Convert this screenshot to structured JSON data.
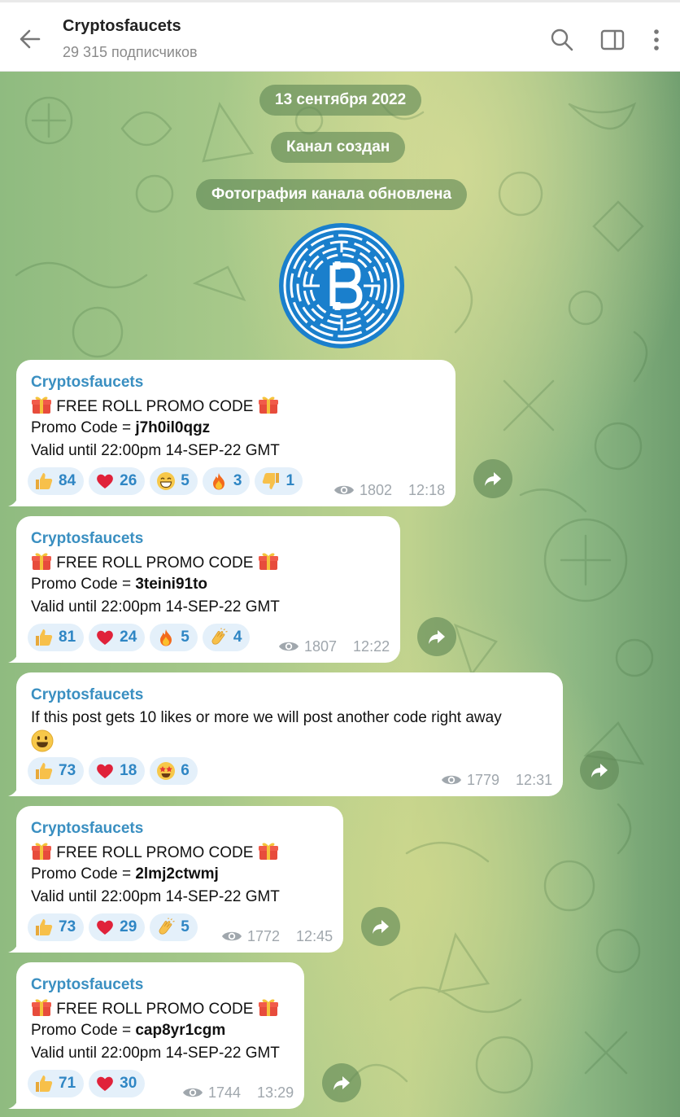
{
  "header": {
    "title": "Cryptosfaucets",
    "subtitle": "29 315 подписчиков",
    "icons": [
      "back-arrow-icon",
      "search-icon",
      "sidebar-panel-icon",
      "more-vertical-icon"
    ]
  },
  "service": {
    "date": "13 сентября 2022",
    "created": "Канал создан",
    "photo_updated": "Фотография канала обновлена"
  },
  "colors": {
    "sender": "#3a8fc1",
    "reaction_bg": "#e4f0fa",
    "reaction_count": "#2f86c4",
    "pill_bg": "#608856"
  },
  "messages": [
    {
      "sender": "Cryptosfaucets",
      "title": "FREE ROLL PROMO CODE",
      "promo_label": "Promo Code = ",
      "promo_code": "j7h0il0qgz",
      "valid": "Valid until 22:00pm 14-SEP-22 GMT",
      "reactions": [
        {
          "emoji": "thumbs-up",
          "count": "84"
        },
        {
          "emoji": "heart",
          "count": "26"
        },
        {
          "emoji": "grin",
          "count": "5"
        },
        {
          "emoji": "fire",
          "count": "3"
        },
        {
          "emoji": "thumbs-down",
          "count": "1"
        }
      ],
      "views": "1802",
      "time": "12:18"
    },
    {
      "sender": "Cryptosfaucets",
      "title": "FREE ROLL PROMO CODE",
      "promo_label": "Promo Code = ",
      "promo_code": "3teini91to",
      "valid": "Valid until 22:00pm 14-SEP-22 GMT",
      "reactions": [
        {
          "emoji": "thumbs-up",
          "count": "81"
        },
        {
          "emoji": "heart",
          "count": "24"
        },
        {
          "emoji": "fire",
          "count": "5"
        },
        {
          "emoji": "clap",
          "count": "4"
        }
      ],
      "views": "1807",
      "time": "12:22"
    },
    {
      "sender": "Cryptosfaucets",
      "text": "If this post gets 10 likes or more we will post another code right away",
      "reactions": [
        {
          "emoji": "thumbs-up",
          "count": "73"
        },
        {
          "emoji": "heart",
          "count": "18"
        },
        {
          "emoji": "star-struck",
          "count": "6"
        }
      ],
      "views": "1779",
      "time": "12:31"
    },
    {
      "sender": "Cryptosfaucets",
      "title": "FREE ROLL PROMO CODE",
      "promo_label": "Promo Code = ",
      "promo_code": "2lmj2ctwmj",
      "valid": "Valid until 22:00pm 14-SEP-22 GMT",
      "reactions": [
        {
          "emoji": "thumbs-up",
          "count": "73"
        },
        {
          "emoji": "heart",
          "count": "29"
        },
        {
          "emoji": "clap",
          "count": "5"
        }
      ],
      "views": "1772",
      "time": "12:45"
    },
    {
      "sender": "Cryptosfaucets",
      "title": "FREE ROLL PROMO CODE",
      "promo_label": "Promo Code = ",
      "promo_code": "cap8yr1cgm",
      "valid": "Valid until 22:00pm 14-SEP-22 GMT",
      "reactions": [
        {
          "emoji": "thumbs-up",
          "count": "71"
        },
        {
          "emoji": "heart",
          "count": "30"
        }
      ],
      "views": "1744",
      "time": "13:29"
    }
  ]
}
